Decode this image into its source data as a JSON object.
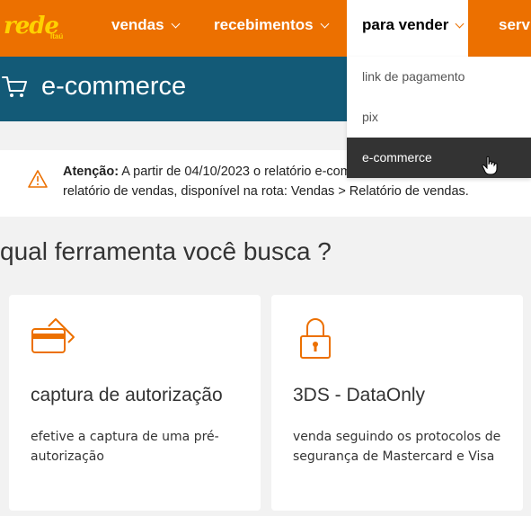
{
  "nav": {
    "logo_text": "rede",
    "logo_sub": "Itaú",
    "items": [
      {
        "label": "vendas"
      },
      {
        "label": "recebimentos"
      },
      {
        "label": "para vender"
      },
      {
        "label": "servi"
      }
    ],
    "dropdown": [
      {
        "label": "link de pagamento"
      },
      {
        "label": "pix"
      },
      {
        "label": "e-commerce"
      }
    ]
  },
  "banner": {
    "title": "e-commerce",
    "icon": "cart-icon"
  },
  "alert": {
    "icon": "warning-icon",
    "bold": "Atenção:",
    "text": " A partir de 04/10/2023 o relatório e-com",
    "line2": "relatório de vendas, disponível na rota: Vendas > Relatório de vendas."
  },
  "section_title": "qual ferramenta você busca ?",
  "cards": [
    {
      "icon": "card-capture-icon",
      "title": "captura de autorização",
      "desc": "efetive a captura de uma pré-autorização"
    },
    {
      "icon": "lock-icon",
      "title": "3DS - DataOnly",
      "desc": "venda seguindo os protocolos de segurança de Mastercard e Visa"
    }
  ],
  "colors": {
    "brand_orange": "#ec7000",
    "brand_yellow": "#ffd200",
    "banner_blue": "#135a77",
    "dropdown_active": "#333333"
  }
}
